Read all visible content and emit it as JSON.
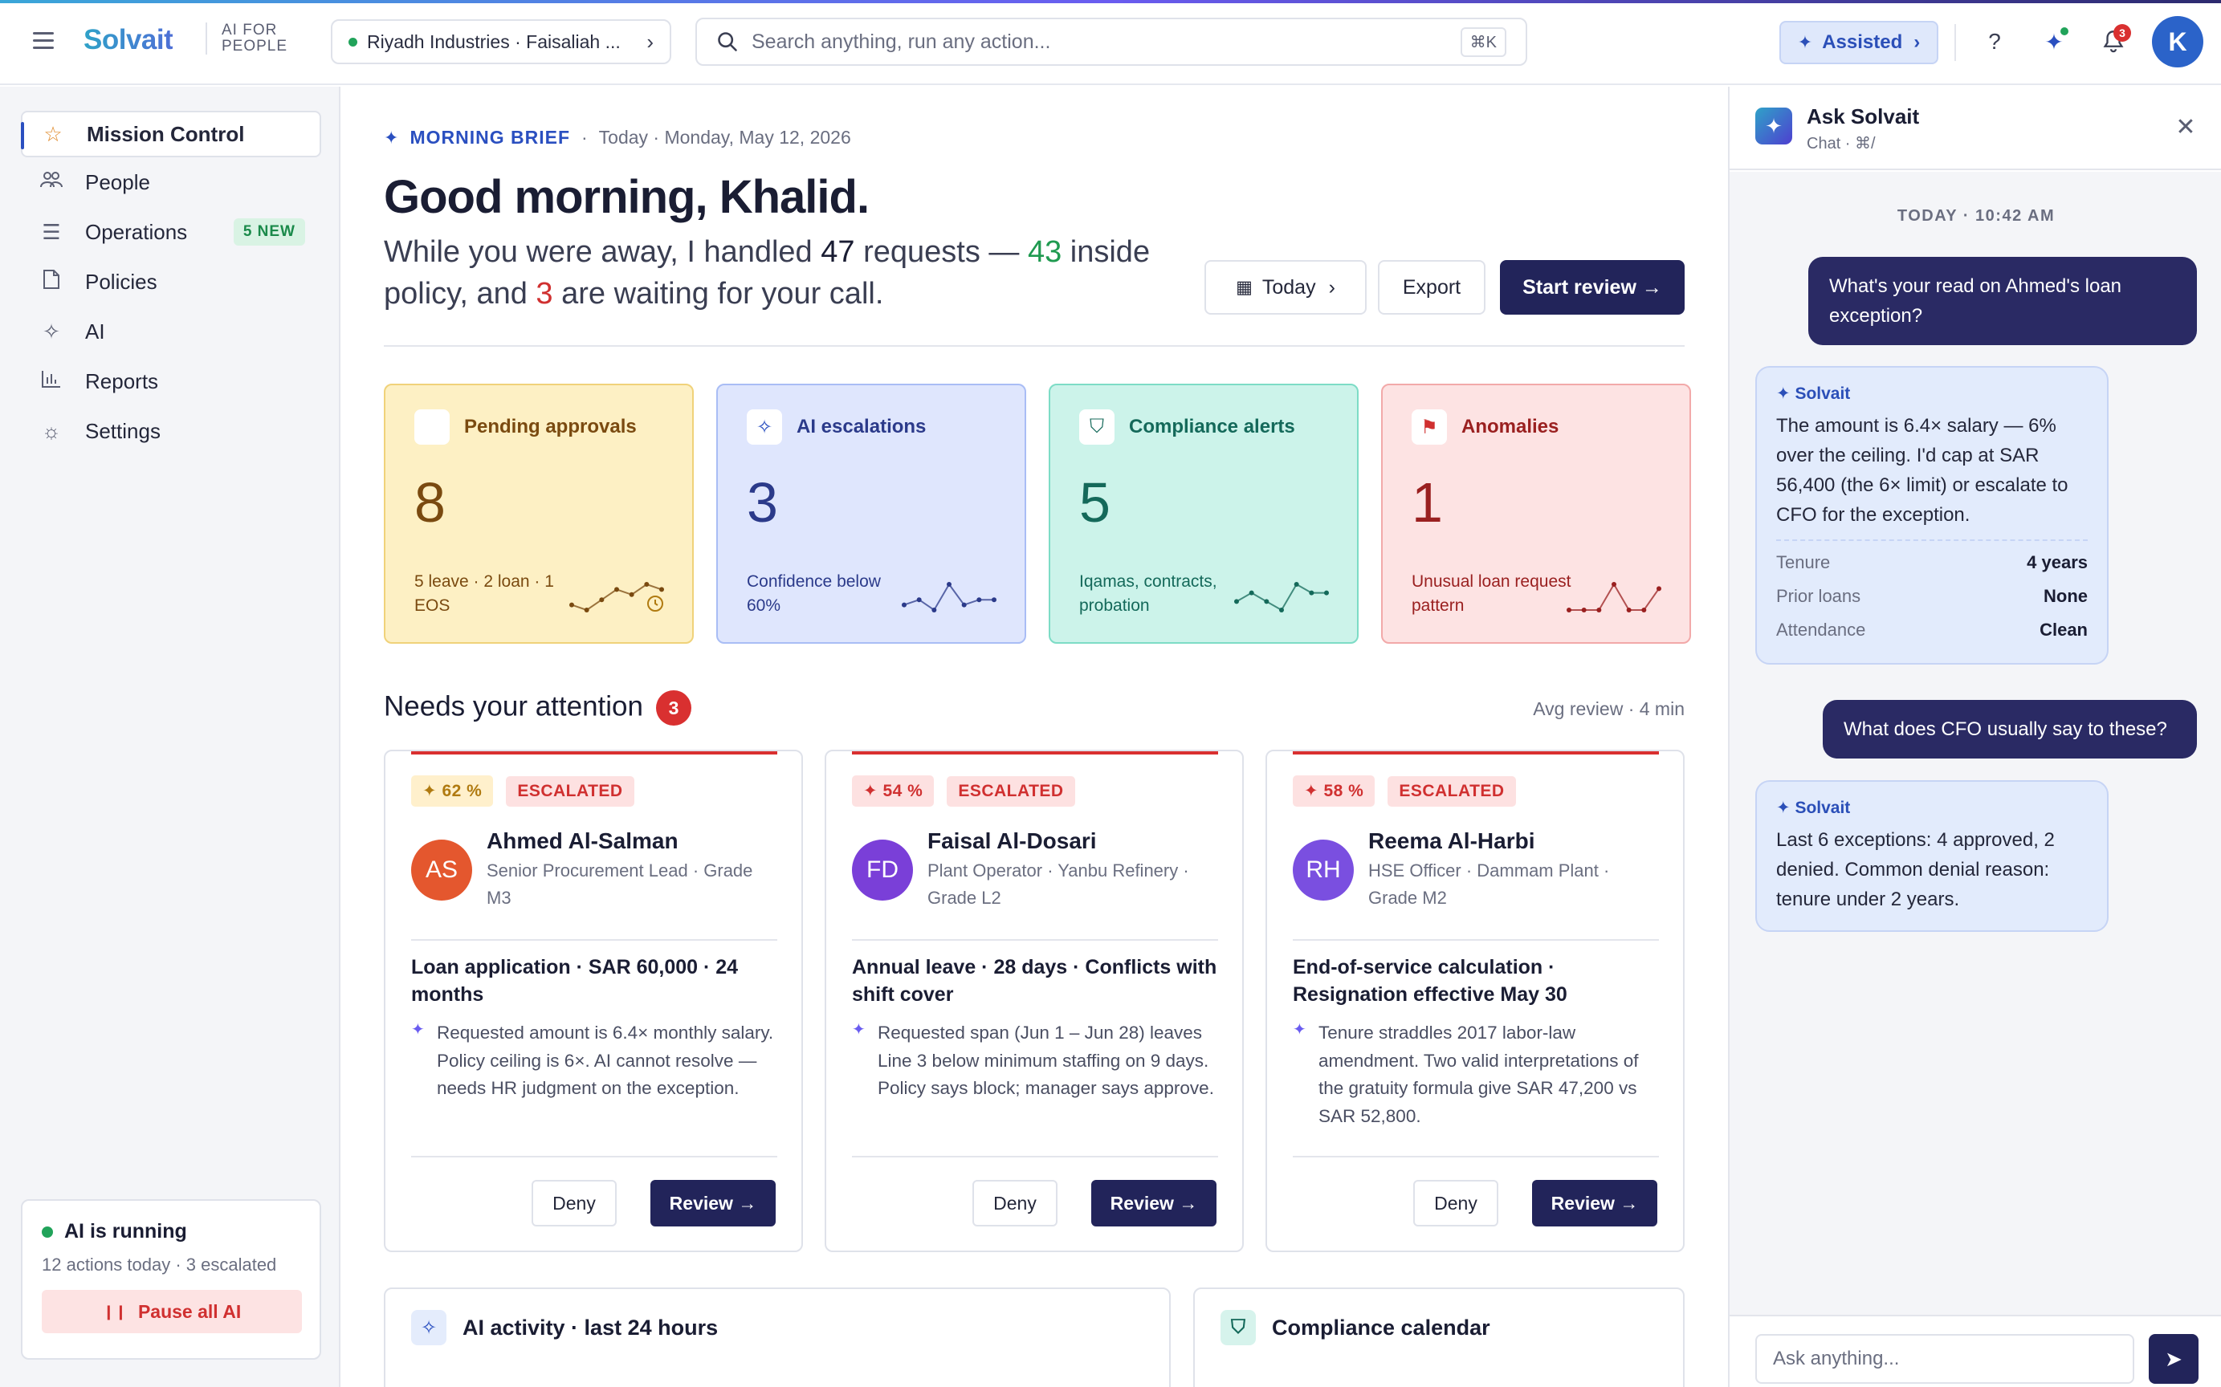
{
  "app": {
    "logo": "Solvait",
    "tagline_1": "AI FOR",
    "tagline_2": "PEOPLE"
  },
  "header": {
    "org_selector": "Riyadh Industries · Faisaliah ...",
    "search_placeholder": "Search anything, run any action...",
    "search_shortcut": "⌘K",
    "mode_label": "Assisted",
    "notification_count": "3",
    "user_initial": "K"
  },
  "sidebar": {
    "items": [
      {
        "label": "Mission Control",
        "icon": "star-icon"
      },
      {
        "label": "People",
        "icon": "people-icon"
      },
      {
        "label": "Operations",
        "icon": "list-icon",
        "badge": "5 NEW"
      },
      {
        "label": "Policies",
        "icon": "document-icon"
      },
      {
        "label": "AI",
        "icon": "sparkle-icon"
      },
      {
        "label": "Reports",
        "icon": "bar-chart-icon"
      },
      {
        "label": "Settings",
        "icon": "gear-icon"
      }
    ],
    "ai_status": {
      "title": "AI is running",
      "detail": "12 actions today · 3 escalated",
      "pause_label": "Pause all AI"
    }
  },
  "brief": {
    "label": "MORNING BRIEF",
    "date": "Today · Monday, May 12, 2026",
    "greeting": "Good morning, Khalid.",
    "summary_1": "While you were away, I handled ",
    "handled": "47",
    "summary_2": " requests — ",
    "inside": "43",
    "summary_3": " inside policy, and ",
    "waiting": "3",
    "summary_4": " are waiting for your call.",
    "today_btn": "Today",
    "export_btn": "Export",
    "review_btn": "Start review →"
  },
  "stats": [
    {
      "title": "Pending approvals",
      "value": "8",
      "detail": "5 leave · 2 loan · 1 EOS",
      "color": "#7a4a10",
      "bg": "#fdf0c4",
      "border": "#f0d27a",
      "spark": [
        3,
        2,
        4,
        6,
        5,
        7,
        6
      ]
    },
    {
      "title": "AI escalations",
      "value": "3",
      "detail": "Confidence below 60%",
      "color": "#2b3a8a",
      "bg": "#dfe6fd",
      "border": "#a9bdf5",
      "spark": [
        2,
        3,
        1,
        6,
        2,
        3,
        3
      ]
    },
    {
      "title": "Compliance alerts",
      "value": "5",
      "detail": "Iqamas, contracts, probation",
      "color": "#14695a",
      "bg": "#ccf3ea",
      "border": "#7ddcc6",
      "spark": [
        3,
        4,
        3,
        2,
        5,
        4,
        4
      ]
    },
    {
      "title": "Anomalies",
      "value": "1",
      "detail": "Unusual loan request pattern",
      "color": "#9a2020",
      "bg": "#fde3e3",
      "border": "#f2a9a9",
      "spark": [
        1,
        1,
        1,
        7,
        1,
        1,
        6
      ]
    }
  ],
  "attention": {
    "title": "Needs your attention",
    "count": "3",
    "avg": "Avg review · 4 min",
    "cards": [
      {
        "confidence": "62 %",
        "conf_style": "y",
        "status": "ESCALATED",
        "initials": "AS",
        "avatar_color": "#e4572e",
        "name": "Ahmed Al-Salman",
        "role": "Senior Procurement Lead · Grade M3",
        "request": "Loan application · SAR 60,000 · 24 months",
        "desc": "Requested amount is 6.4× monthly salary. Policy ceiling is 6×. AI cannot resolve — needs HR judgment on the exception.",
        "deny": "Deny",
        "review": "Review →"
      },
      {
        "confidence": "54 %",
        "conf_style": "r",
        "status": "ESCALATED",
        "initials": "FD",
        "avatar_color": "#7a3fd8",
        "name": "Faisal Al-Dosari",
        "role": "Plant Operator · Yanbu Refinery · Grade L2",
        "request": "Annual leave · 28 days · Conflicts with shift cover",
        "desc": "Requested span (Jun 1 – Jun 28) leaves Line 3 below minimum staffing on 9 days. Policy says block; manager says approve.",
        "deny": "Deny",
        "review": "Review →"
      },
      {
        "confidence": "58 %",
        "conf_style": "r",
        "status": "ESCALATED",
        "initials": "RH",
        "avatar_color": "#7a4fe0",
        "name": "Reema Al-Harbi",
        "role": "HSE Officer · Dammam Plant · Grade M2",
        "request": "End-of-service calculation · Resignation effective May 30",
        "desc": "Tenure straddles 2017 labor-law amendment. Two valid interpretations of the gratuity formula give SAR 47,200 vs SAR 52,800.",
        "deny": "Deny",
        "review": "Review →"
      }
    ]
  },
  "panels": {
    "activity": "AI activity · last 24 hours",
    "calendar": "Compliance calendar"
  },
  "chat": {
    "title": "Ask Solvait",
    "subtitle": "Chat · ⌘/",
    "timestamp": "TODAY · 10:42 AM",
    "user_msg_1": "What's your read on Ahmed's loan exception?",
    "ai_name": "Solvait",
    "ai_msg_1": "The amount is 6.4× salary — 6% over the ceiling. I'd cap at SAR 56,400 (the 6× limit) or escalate to CFO for the exception.",
    "facts": [
      {
        "k": "Tenure",
        "v": "4 years"
      },
      {
        "k": "Prior loans",
        "v": "None"
      },
      {
        "k": "Attendance",
        "v": "Clean"
      }
    ],
    "user_msg_2": "What does CFO usually say to these?",
    "ai_msg_2": "Last 6 exceptions: 4 approved, 2 denied. Common denial reason: tenure under 2 years.",
    "input_placeholder": "Ask anything..."
  }
}
